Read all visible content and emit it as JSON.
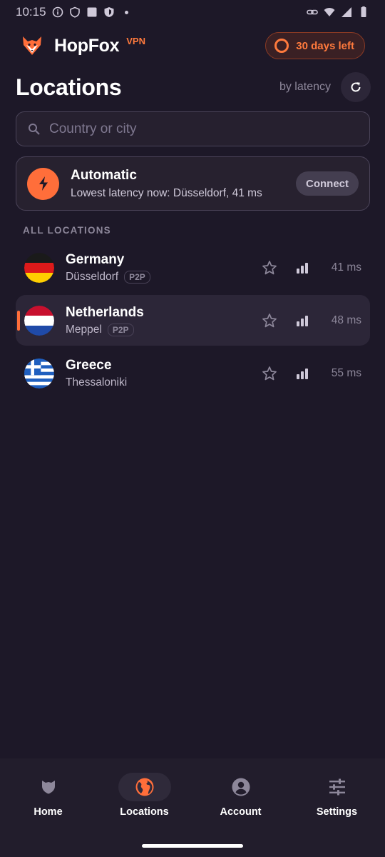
{
  "status_bar": {
    "time": "10:15"
  },
  "header": {
    "brand": "HopFox",
    "brand_tag": "VPN",
    "trial_label": "30 days left"
  },
  "page": {
    "title": "Locations",
    "sort_label": "by latency"
  },
  "search": {
    "placeholder": "Country or city"
  },
  "automatic": {
    "title": "Automatic",
    "subtitle": "Lowest latency now: Düsseldorf, 41 ms",
    "connect_label": "Connect"
  },
  "section_label": "ALL LOCATIONS",
  "locations": [
    {
      "name": "Germany",
      "city": "Düsseldorf",
      "tag": "P2P",
      "latency": "41 ms",
      "selected": false
    },
    {
      "name": "Netherlands",
      "city": "Meppel",
      "tag": "P2P",
      "latency": "48 ms",
      "selected": true
    },
    {
      "name": "Greece",
      "city": "Thessaloniki",
      "tag": "",
      "latency": "55 ms",
      "selected": false
    }
  ],
  "nav": [
    {
      "label": "Home",
      "icon": "shield-icon",
      "active": false
    },
    {
      "label": "Locations",
      "icon": "globe-icon",
      "active": true
    },
    {
      "label": "Account",
      "icon": "account-icon",
      "active": false
    },
    {
      "label": "Settings",
      "icon": "sliders-icon",
      "active": false
    }
  ],
  "colors": {
    "accent": "#ff6e3a",
    "background": "#1d1828",
    "card": "#27212f"
  }
}
